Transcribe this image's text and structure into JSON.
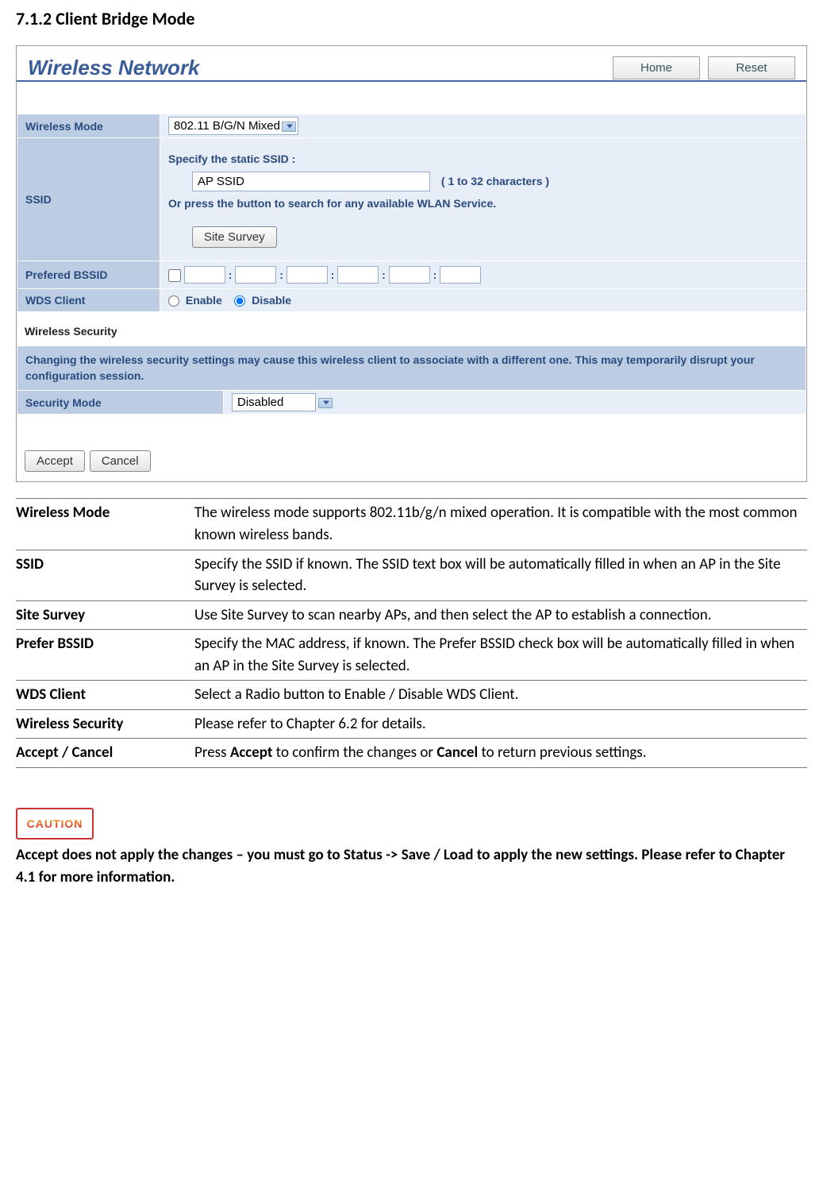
{
  "section_title": "7.1.2 Client Bridge Mode",
  "panel": {
    "title": "Wireless Network",
    "home_btn": "Home",
    "reset_btn": "Reset"
  },
  "form": {
    "wireless_mode_label": "Wireless Mode",
    "wireless_mode_value": "802.11 B/G/N Mixed",
    "ssid_label": "SSID",
    "ssid_specify": "Specify the static SSID  :",
    "ssid_value": "AP SSID",
    "ssid_chars": "( 1 to 32 characters )",
    "ssid_or": "Or press the button to search for any available WLAN Service.",
    "site_survey_btn": "Site Survey",
    "bssid_label": "Prefered BSSID",
    "wds_label": "WDS Client",
    "wds_enable": "Enable",
    "wds_disable": "Disable",
    "wsec_heading": "Wireless Security",
    "wsec_warning": "Changing the wireless security settings may cause this wireless client to associate with a different one. This may temporarily disrupt your configuration session.",
    "sec_mode_label": "Security Mode",
    "sec_mode_value": "Disabled",
    "accept_btn": "Accept",
    "cancel_btn": "Cancel"
  },
  "desc": [
    {
      "label": "Wireless Mode",
      "text": "The wireless mode supports 802.11b/g/n mixed operation. It is compatible with the most common known wireless bands."
    },
    {
      "label": "SSID",
      "text": "Specify the SSID if known. The SSID text box will be automatically filled in when an AP in the Site Survey is selected."
    },
    {
      "label": "Site Survey",
      "text": "Use Site Survey to scan nearby APs, and then select the AP to establish a connection."
    },
    {
      "label": "Prefer BSSID",
      "text": "Specify the MAC address, if known. The Prefer BSSID check box will be automatically filled in when an AP in the Site Survey is selected."
    },
    {
      "label": "WDS Client",
      "text": "Select a Radio button to Enable / Disable WDS Client."
    },
    {
      "label": "Wireless Security",
      "text": "Please refer to Chapter 6.2 for details."
    },
    {
      "label": "Accept / Cancel",
      "text_parts": [
        "Press ",
        "Accept",
        " to confirm the changes or ",
        "Cancel",
        " to return previous settings."
      ]
    }
  ],
  "caution": {
    "badge": "CAUTION",
    "note": "Accept does not apply the changes – you must go to Status -> Save / Load to apply the new settings. Please refer to Chapter 4.1 for more information."
  }
}
